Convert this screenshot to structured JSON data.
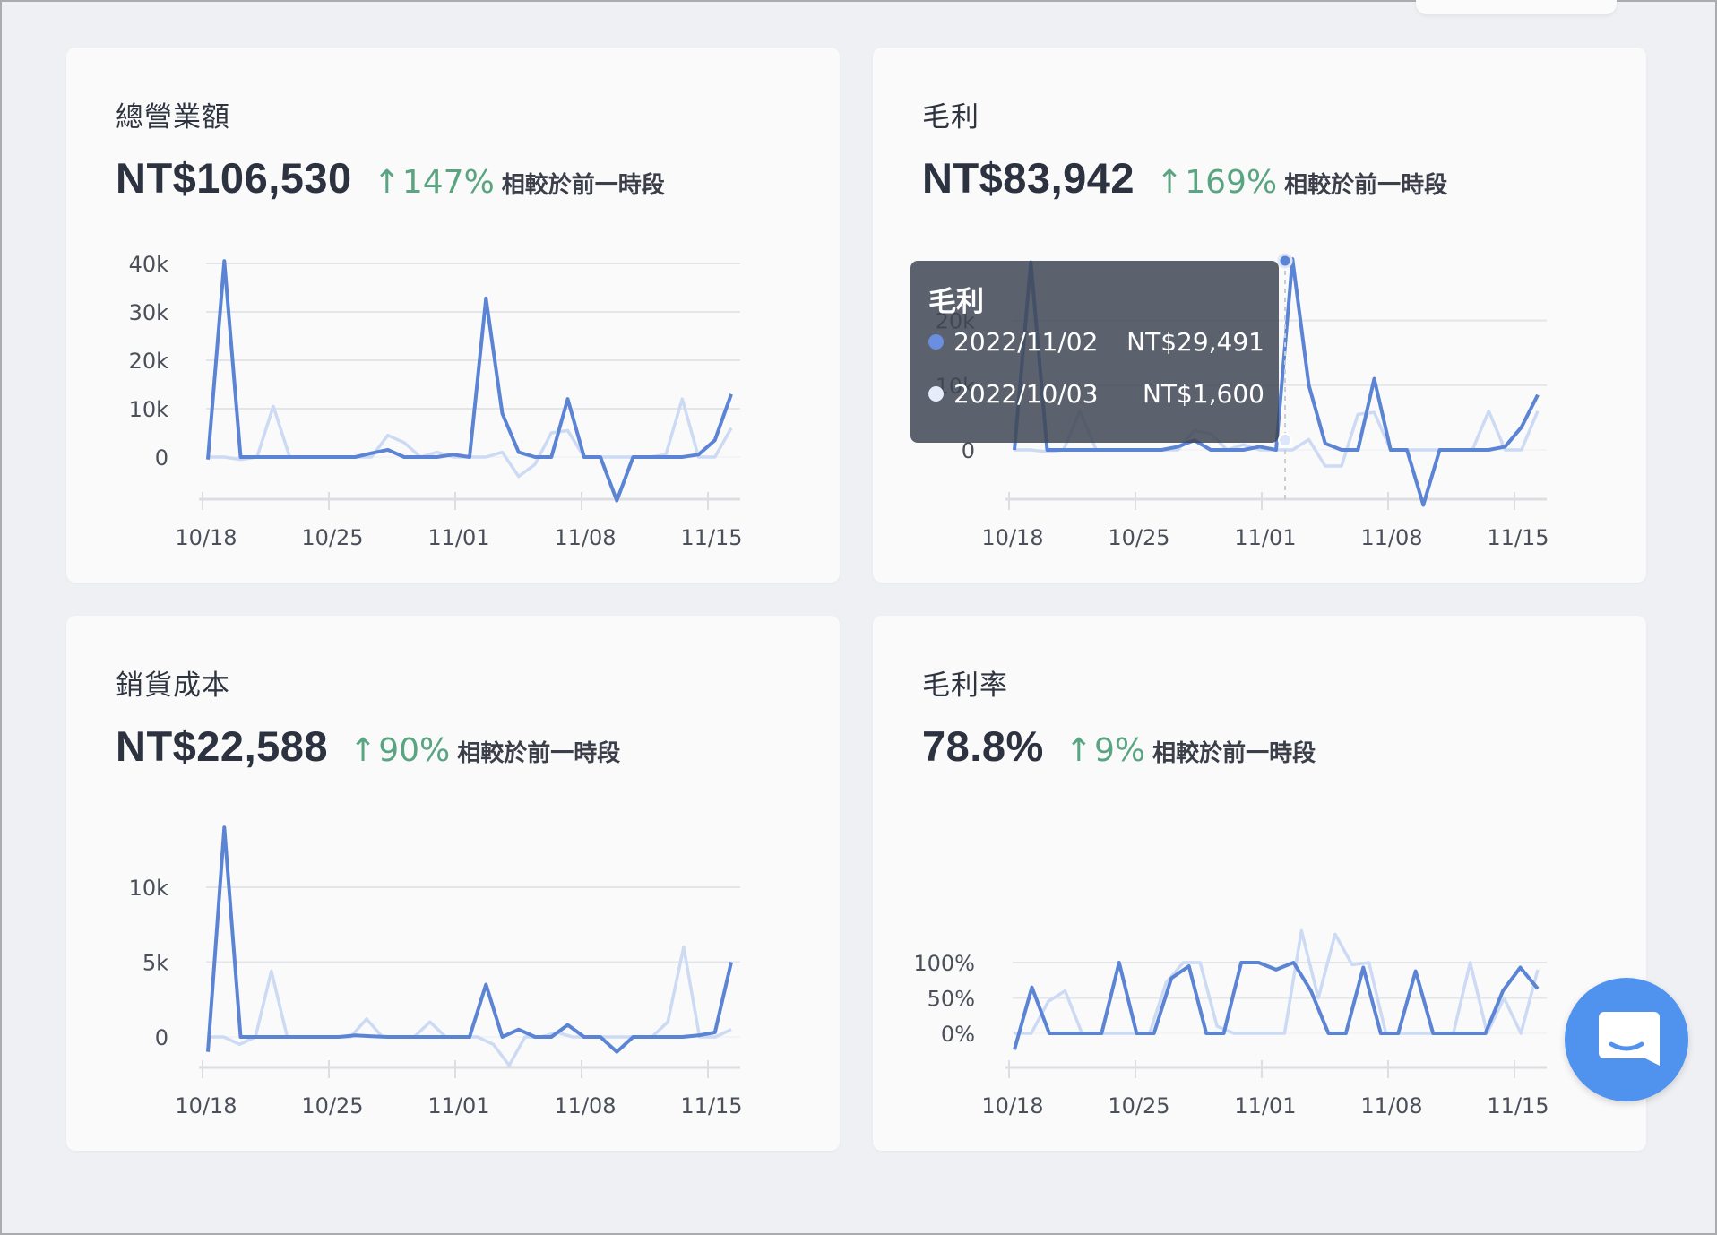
{
  "cards": [
    {
      "title": "總營業額",
      "value": "NT$106,530",
      "change_arrow": "↑",
      "change_pct": "147%",
      "compare_label": "相較於前一時段"
    },
    {
      "title": "毛利",
      "value": "NT$83,942",
      "change_arrow": "↑",
      "change_pct": "169%",
      "compare_label": "相較於前一時段"
    },
    {
      "title": "銷貨成本",
      "value": "NT$22,588",
      "change_arrow": "↑",
      "change_pct": "90%",
      "compare_label": "相較於前一時段"
    },
    {
      "title": "毛利率",
      "value": "78.8%",
      "change_arrow": "↑",
      "change_pct": "9%",
      "compare_label": "相較於前一時段"
    }
  ],
  "tooltip": {
    "title": "毛利",
    "rows": [
      {
        "date": "2022/11/02",
        "amount": "NT$29,491",
        "color": "#6a8ee0"
      },
      {
        "date": "2022/10/03",
        "amount": "NT$1,600",
        "color": "#e6ecfa"
      }
    ]
  },
  "colors": {
    "current_series": "#5b84d4",
    "previous_series": "#cddaf4",
    "grid": "#e3e5e8",
    "axis": "#dcdee2",
    "up": "#5aa581"
  },
  "icons": {
    "chat": "chat-bubble-icon"
  },
  "chart_data": [
    {
      "type": "line",
      "title": "總營業額",
      "x_ticks": [
        "10/18",
        "10/25",
        "11/01",
        "11/08",
        "11/15"
      ],
      "y_ticks": [
        0,
        10000,
        20000,
        30000,
        40000
      ],
      "y_tick_labels": [
        "0",
        "10k",
        "20k",
        "30k",
        "40k"
      ],
      "ylim": [
        -8500,
        40000
      ],
      "grid": true,
      "series": [
        {
          "values": [
            -500,
            40500,
            0,
            0,
            0,
            0,
            0,
            0,
            0,
            0,
            800,
            1500,
            0,
            0,
            0,
            500,
            0,
            32800,
            9000,
            1000,
            0,
            0,
            12000,
            0,
            0,
            -9000,
            0,
            0,
            0,
            0,
            500,
            3500,
            13000
          ]
        },
        {
          "values": [
            0,
            0,
            -500,
            0,
            10500,
            0,
            0,
            0,
            0,
            0,
            0,
            4500,
            3000,
            0,
            1000,
            0,
            0,
            0,
            1000,
            -4000,
            -1500,
            5000,
            5500,
            0,
            0,
            0,
            0,
            0,
            500,
            12000,
            0,
            0,
            6000
          ]
        }
      ]
    },
    {
      "type": "line",
      "title": "毛利",
      "x_ticks": [
        "10/18",
        "10/25",
        "11/01",
        "11/08",
        "11/15"
      ],
      "y_ticks": [
        0,
        10000,
        20000
      ],
      "y_tick_labels": [
        "0",
        "10k",
        "20k"
      ],
      "ylim": [
        -8500,
        30000
      ],
      "grid": true,
      "series": [
        {
          "values": [
            0,
            29000,
            0,
            0,
            0,
            0,
            0,
            0,
            0,
            0,
            500,
            1500,
            0,
            0,
            0,
            500,
            0,
            29491,
            10000,
            1000,
            0,
            0,
            11000,
            0,
            0,
            -8500,
            0,
            0,
            0,
            0,
            500,
            3500,
            8500
          ]
        },
        {
          "values": [
            0,
            0,
            -300,
            0,
            6000,
            0,
            0,
            0,
            0,
            0,
            0,
            3000,
            2500,
            0,
            800,
            0,
            0,
            0,
            1600,
            -2500,
            -2500,
            5500,
            5800,
            0,
            0,
            0,
            0,
            0,
            0,
            6000,
            0,
            0,
            6000
          ]
        }
      ]
    },
    {
      "type": "line",
      "title": "銷貨成本",
      "x_ticks": [
        "10/18",
        "10/25",
        "11/01",
        "11/08",
        "11/15"
      ],
      "y_ticks": [
        0,
        5000,
        10000
      ],
      "y_tick_labels": [
        "0",
        "5k",
        "10k"
      ],
      "ylim": [
        -2000,
        14000
      ],
      "grid": true,
      "series": [
        {
          "values": [
            -1000,
            14000,
            0,
            0,
            0,
            0,
            0,
            0,
            0,
            100,
            50,
            0,
            0,
            0,
            0,
            0,
            0,
            3500,
            0,
            500,
            0,
            0,
            800,
            0,
            0,
            -1000,
            0,
            0,
            0,
            0,
            100,
            300,
            5000
          ]
        },
        {
          "values": [
            0,
            0,
            -500,
            0,
            4400,
            0,
            0,
            0,
            0,
            0,
            1200,
            0,
            0,
            0,
            1000,
            0,
            0,
            0,
            -500,
            -1900,
            0,
            0,
            300,
            0,
            0,
            0,
            0,
            0,
            0,
            1000,
            6000,
            0,
            0,
            500
          ]
        }
      ]
    },
    {
      "type": "line",
      "title": "毛利率",
      "x_ticks": [
        "10/18",
        "10/25",
        "11/01",
        "11/08",
        "11/15"
      ],
      "y_ticks": [
        0,
        50,
        100
      ],
      "y_tick_labels": [
        "0%",
        "50%",
        "100%"
      ],
      "ylim": [
        -23,
        145
      ],
      "grid": true,
      "series": [
        {
          "values": [
            -23,
            65,
            0,
            0,
            0,
            0,
            100,
            0,
            0,
            78,
            95,
            0,
            0,
            100,
            100,
            90,
            100,
            60,
            0,
            0,
            93,
            0,
            0,
            88,
            0,
            0,
            0,
            0,
            60,
            93,
            63
          ]
        },
        {
          "values": [
            0,
            0,
            45,
            60,
            0,
            0,
            0,
            0,
            0,
            72,
            100,
            100,
            10,
            0,
            0,
            0,
            0,
            145,
            50,
            140,
            97,
            100,
            0,
            0,
            0,
            0,
            0,
            100,
            0,
            50,
            0,
            90
          ]
        }
      ]
    }
  ]
}
